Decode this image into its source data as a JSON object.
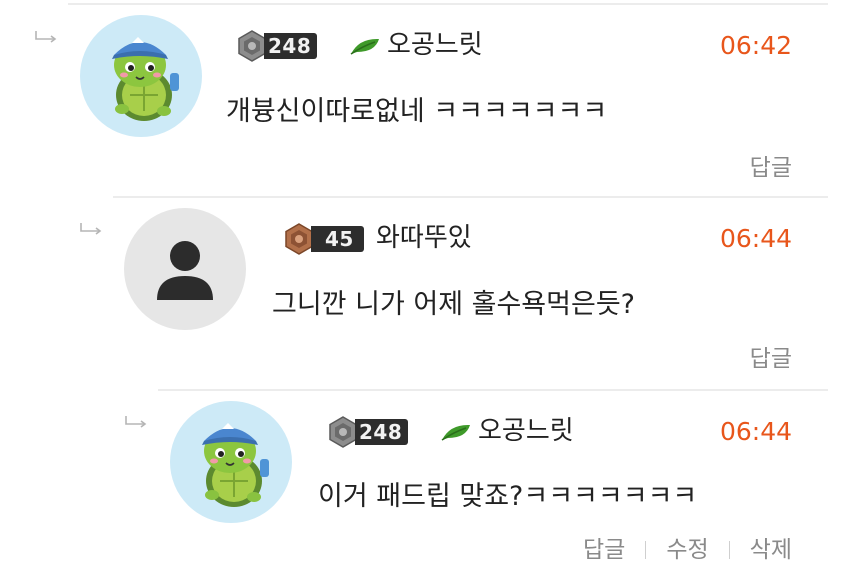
{
  "colors": {
    "time": "#e8561b",
    "action_text": "#8a8a8a",
    "divider": "#ececec",
    "mascot_bg": "#cdeaf7",
    "default_avatar_bg": "#e6e6e6",
    "leaf": "#3f9a2a"
  },
  "comments": [
    {
      "avatar": "turtle-mascot-icon",
      "level": "248",
      "has_leaf_icon": true,
      "nickname": "오공느릿",
      "time": "06:42",
      "message": "개븅신이따로없네 ㅋㅋㅋㅋㅋㅋㅋ",
      "actions": [
        "답글"
      ]
    },
    {
      "avatar": "user-silhouette-icon",
      "level": "45",
      "has_leaf_icon": false,
      "nickname": "와따뚜있",
      "time": "06:44",
      "message": "그니깐 니가 어제 홀수욕먹은듯?",
      "actions": [
        "답글"
      ]
    },
    {
      "avatar": "turtle-mascot-icon",
      "level": "248",
      "has_leaf_icon": true,
      "nickname": "오공느릿",
      "time": "06:44",
      "message": "이거 패드립 맞죠?ㅋㅋㅋㅋㅋㅋㅋ",
      "actions": [
        "답글",
        "수정",
        "삭제"
      ]
    }
  ]
}
